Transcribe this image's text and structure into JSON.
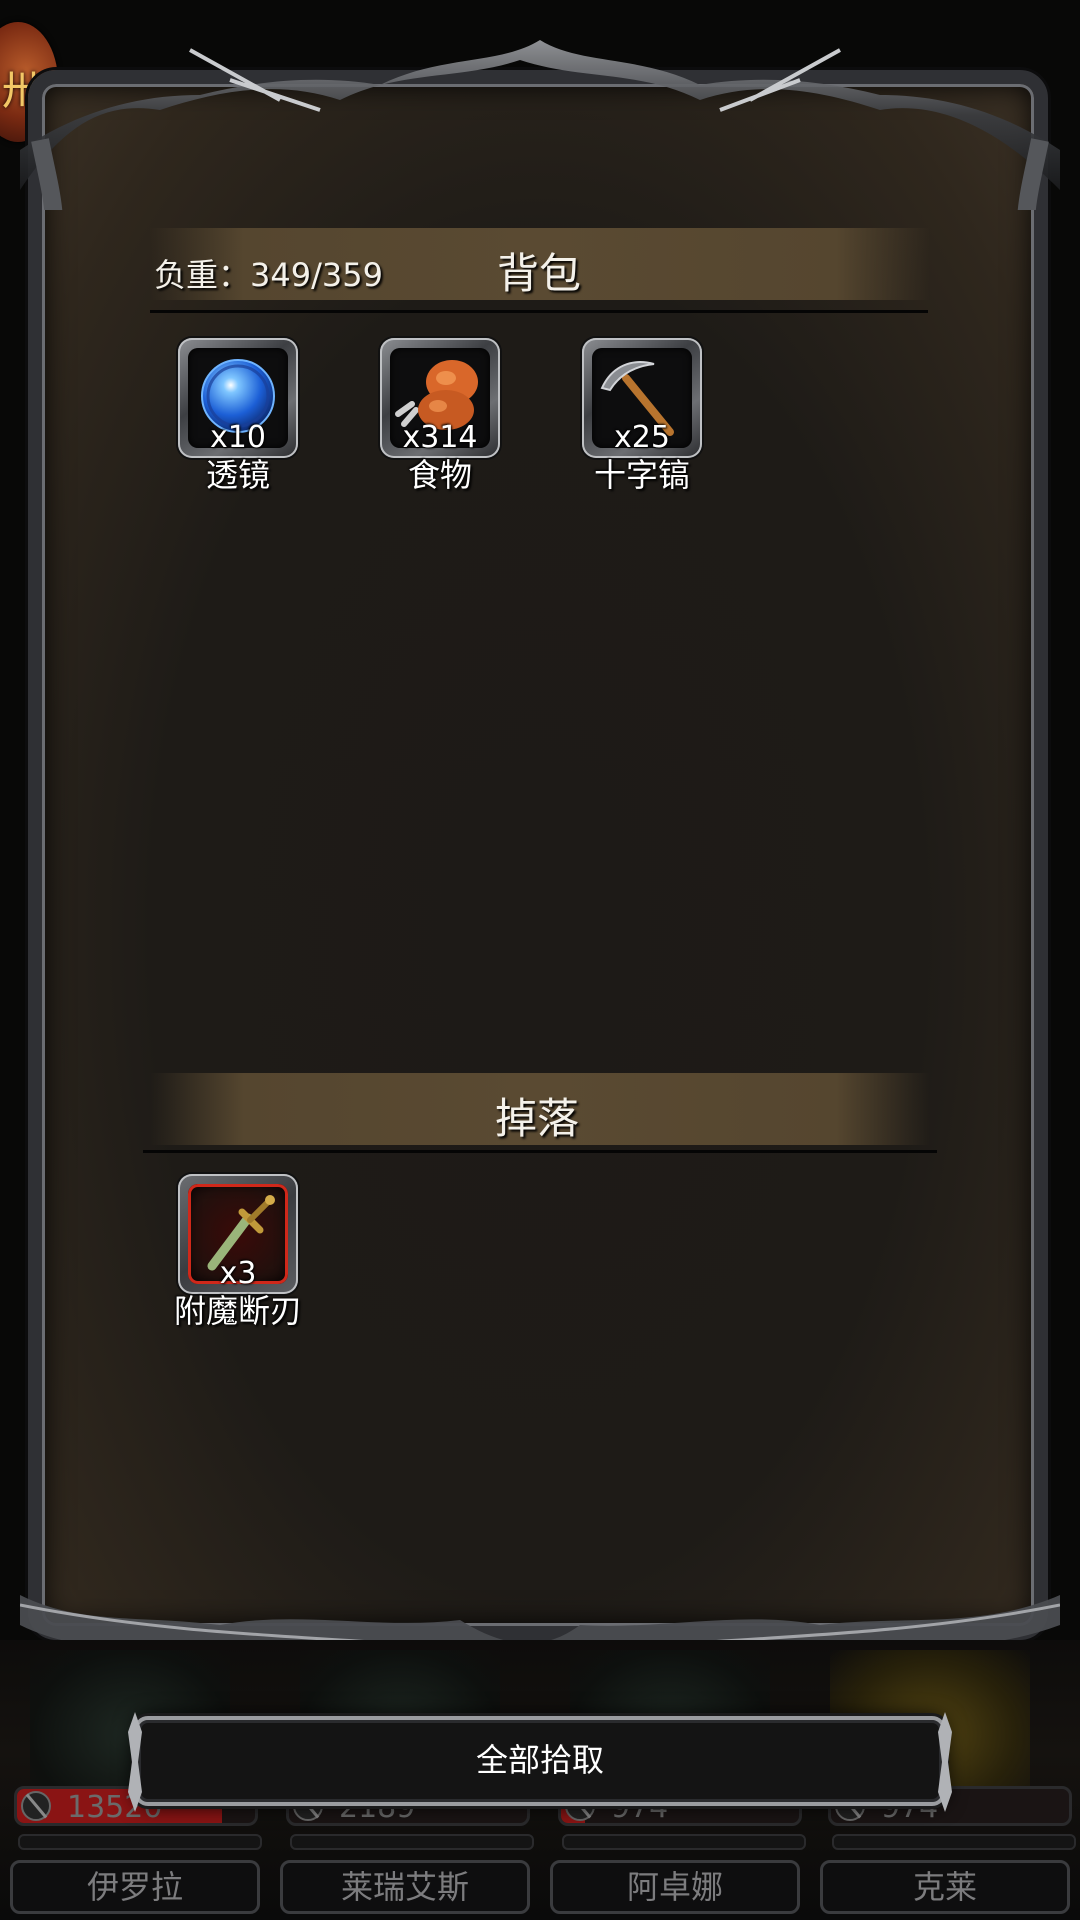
{
  "backpack": {
    "title": "背包",
    "weight_label": "负重：349/359",
    "items": [
      {
        "name": "透镜",
        "qty": "x10",
        "icon": "blue-orb-lens-icon"
      },
      {
        "name": "食物",
        "qty": "x314",
        "icon": "meat-drumstick-icon"
      },
      {
        "name": "十字镐",
        "qty": "x25",
        "icon": "pickaxe-icon"
      }
    ]
  },
  "drops": {
    "title": "掉落",
    "items": [
      {
        "name": "附魔断刃",
        "qty": "x3",
        "icon": "broken-sword-icon"
      }
    ]
  },
  "collect_all_label": "全部拾取",
  "party": [
    {
      "name": "伊罗拉",
      "hp": "13520",
      "hp_fill": 0.86
    },
    {
      "name": "莱瑞艾斯",
      "hp": "2189",
      "hp_fill": 0.0
    },
    {
      "name": "阿卓娜",
      "hp": "974",
      "hp_fill": 0.1
    },
    {
      "name": "克莱",
      "hp": "974",
      "hp_fill": 0.0
    }
  ],
  "colors": {
    "hp_red": "#8a1414",
    "rare_border": "#d0281a",
    "header_band": "#5a4a32"
  }
}
